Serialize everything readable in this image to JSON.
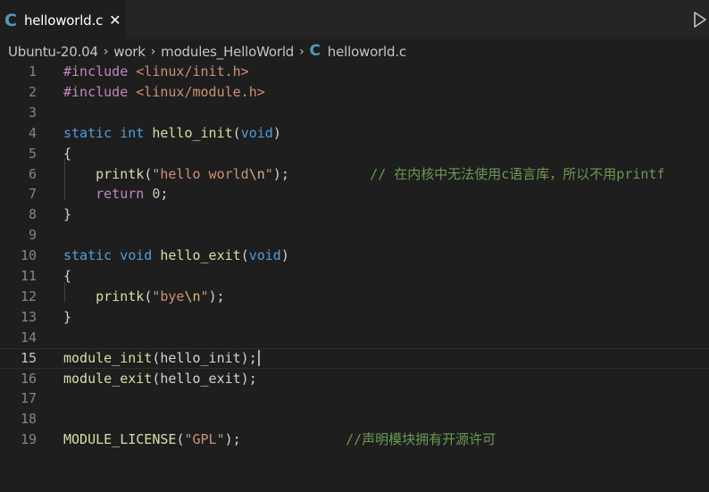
{
  "tab": {
    "icon": "c-language-icon",
    "icon_glyph": "C",
    "label": "helloworld.c",
    "close_glyph": "✕"
  },
  "run_button": {
    "icon": "play-icon"
  },
  "breadcrumb": {
    "segments": [
      "Ubuntu-20.04",
      "work",
      "modules_HelloWorld"
    ],
    "file_icon_glyph": "C",
    "file": "helloworld.c",
    "separator": "›"
  },
  "editor": {
    "current_line": 15,
    "lines": [
      {
        "n": "1",
        "tokens": [
          [
            "pp",
            "#include"
          ],
          [
            "plain",
            " "
          ],
          [
            "inc",
            "<linux/init.h>"
          ]
        ]
      },
      {
        "n": "2",
        "tokens": [
          [
            "pp",
            "#include"
          ],
          [
            "plain",
            " "
          ],
          [
            "inc",
            "<linux/module.h>"
          ]
        ]
      },
      {
        "n": "3",
        "tokens": []
      },
      {
        "n": "4",
        "tokens": [
          [
            "kw",
            "static"
          ],
          [
            "plain",
            " "
          ],
          [
            "kw",
            "int"
          ],
          [
            "plain",
            " "
          ],
          [
            "fn",
            "hello_init"
          ],
          [
            "plain",
            "("
          ],
          [
            "kw",
            "void"
          ],
          [
            "plain",
            ")"
          ]
        ]
      },
      {
        "n": "5",
        "tokens": [
          [
            "plain",
            "{"
          ]
        ]
      },
      {
        "n": "6",
        "tokens": [
          [
            "plain",
            "    "
          ],
          [
            "fn",
            "printk"
          ],
          [
            "plain",
            "("
          ],
          [
            "str",
            "\"hello world"
          ],
          [
            "esc",
            "\\n"
          ],
          [
            "str",
            "\""
          ],
          [
            "plain",
            ");"
          ],
          [
            "plain",
            "          "
          ],
          [
            "cmt",
            "// 在内核中无法使用c语言库，所以不用printf"
          ]
        ]
      },
      {
        "n": "7",
        "tokens": [
          [
            "plain",
            "    "
          ],
          [
            "ctl",
            "return"
          ],
          [
            "plain",
            " "
          ],
          [
            "num",
            "0"
          ],
          [
            "plain",
            ";"
          ]
        ]
      },
      {
        "n": "8",
        "tokens": [
          [
            "plain",
            "}"
          ]
        ]
      },
      {
        "n": "9",
        "tokens": []
      },
      {
        "n": "10",
        "tokens": [
          [
            "kw",
            "static"
          ],
          [
            "plain",
            " "
          ],
          [
            "kw",
            "void"
          ],
          [
            "plain",
            " "
          ],
          [
            "fn",
            "hello_exit"
          ],
          [
            "plain",
            "("
          ],
          [
            "kw",
            "void"
          ],
          [
            "plain",
            ")"
          ]
        ]
      },
      {
        "n": "11",
        "tokens": [
          [
            "plain",
            "{"
          ]
        ]
      },
      {
        "n": "12",
        "tokens": [
          [
            "plain",
            "    "
          ],
          [
            "fn",
            "printk"
          ],
          [
            "plain",
            "("
          ],
          [
            "str",
            "\"bye"
          ],
          [
            "esc",
            "\\n"
          ],
          [
            "str",
            "\""
          ],
          [
            "plain",
            ");"
          ]
        ]
      },
      {
        "n": "13",
        "tokens": [
          [
            "plain",
            "}"
          ]
        ]
      },
      {
        "n": "14",
        "tokens": []
      },
      {
        "n": "15",
        "tokens": [
          [
            "fn",
            "module_init"
          ],
          [
            "plain",
            "(hello_init);"
          ]
        ]
      },
      {
        "n": "16",
        "tokens": [
          [
            "fn",
            "module_exit"
          ],
          [
            "plain",
            "(hello_exit);"
          ]
        ]
      },
      {
        "n": "17",
        "tokens": []
      },
      {
        "n": "18",
        "tokens": []
      },
      {
        "n": "19",
        "tokens": [
          [
            "fn",
            "MODULE_LICENSE"
          ],
          [
            "plain",
            "("
          ],
          [
            "str",
            "\"GPL\""
          ],
          [
            "plain",
            ");"
          ],
          [
            "plain",
            "             "
          ],
          [
            "cmt",
            "//声明模块拥有开源许可"
          ]
        ]
      }
    ]
  },
  "colors": {
    "background": "#1e1e1e",
    "tabbar": "#252526",
    "keyword": "#569cd6",
    "function": "#dcdcaa",
    "string": "#ce9178",
    "comment": "#6a9955",
    "preprocessor": "#c586c0",
    "number": "#b5cea8"
  }
}
